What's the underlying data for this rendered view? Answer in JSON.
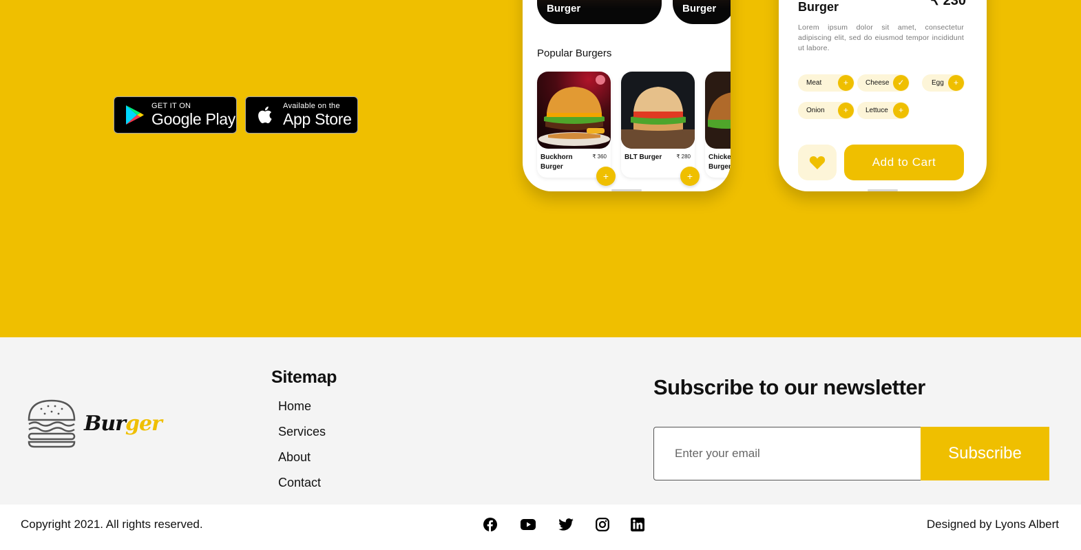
{
  "colors": {
    "brand_yellow": "#efbf00",
    "footer_bg": "#f4f4f4",
    "chip_bg": "#fdf5d8",
    "text": "#111111"
  },
  "badges": {
    "google": {
      "small": "GET IT ON",
      "big": "Google Play",
      "icon": "google-play-icon"
    },
    "apple": {
      "small": "Available on the",
      "big": "App Store",
      "icon": "apple-icon"
    }
  },
  "phone1": {
    "categories": [
      "Burger",
      "Burger"
    ],
    "heading": "Popular Burgers",
    "items": [
      {
        "name": "Buckhorn Burger",
        "price": "₹ 360",
        "add": "+"
      },
      {
        "name": "BLT Burger",
        "price": "₹ 280",
        "add": "+"
      },
      {
        "name": "Chicken Burger",
        "price": ""
      }
    ]
  },
  "phone2": {
    "title": "Burger",
    "price": "₹ 230",
    "description": "Lorem ipsum dolor sit amet, consectetur adipiscing elit, sed do eiusmod tempor incididunt ut labore.",
    "ingredients": [
      {
        "label": "Meat",
        "action": "+"
      },
      {
        "label": "Cheese",
        "action": "✓"
      },
      {
        "label": "Egg",
        "action": "+"
      },
      {
        "label": "Onion",
        "action": "+"
      },
      {
        "label": "Lettuce",
        "action": "+"
      }
    ],
    "favorite_icon": "heart-icon",
    "cart_label": "Add to Cart"
  },
  "footer": {
    "logo": {
      "word_black": "Bur",
      "word_yellow": "ger",
      "icon": "burger-icon"
    },
    "sitemap": {
      "title": "Sitemap",
      "links": [
        "Home",
        "Services",
        "About",
        "Contact"
      ]
    },
    "newsletter": {
      "title": "Subscribe to our newsletter",
      "placeholder": "Enter your email",
      "button": "Subscribe"
    }
  },
  "bottom": {
    "copyright": "Copyright 2021. All rights reserved.",
    "designer": "Designed by Lyons Albert",
    "social": [
      "facebook-icon",
      "youtube-icon",
      "twitter-icon",
      "instagram-icon",
      "linkedin-icon"
    ]
  }
}
